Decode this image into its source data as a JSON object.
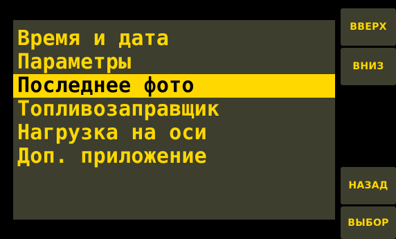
{
  "menu": {
    "items": [
      {
        "label": "Время и дата",
        "selected": false
      },
      {
        "label": "Параметры",
        "selected": false
      },
      {
        "label": "Последнее фото",
        "selected": true
      },
      {
        "label": "Топливозаправщик",
        "selected": false
      },
      {
        "label": "Нагрузка на оси",
        "selected": false
      },
      {
        "label": "Доп. приложение",
        "selected": false
      }
    ],
    "selected_index": 2
  },
  "buttons": {
    "up": "ВВЕРХ",
    "down": "ВНИЗ",
    "back": "НАЗАД",
    "select": "ВЫБОР"
  },
  "colors": {
    "background": "#000000",
    "panel": "#3d3e2e",
    "text": "#ffd800",
    "highlight": "#ffd800",
    "highlight_text": "#000000"
  }
}
